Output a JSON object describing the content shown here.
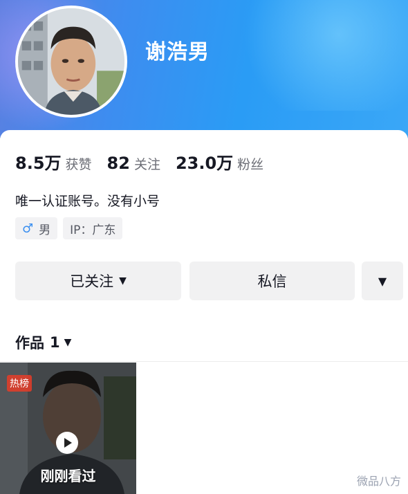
{
  "profile": {
    "nickname": "谢浩男",
    "bio": "唯一认证账号。没有小号"
  },
  "stats": [
    {
      "num": "8.5万",
      "label": "获赞"
    },
    {
      "num": "82",
      "label": "关注"
    },
    {
      "num": "23.0万",
      "label": "粉丝"
    }
  ],
  "tags": {
    "gender_icon": "♂",
    "gender": "男",
    "ip": "IP：广东"
  },
  "buttons": {
    "follow": "已关注",
    "follow_caret": "▼",
    "message": "私信",
    "more": "▼"
  },
  "works": {
    "label": "作品",
    "count": "1",
    "caret": "▼",
    "items": [
      {
        "badge": "热榜",
        "status": "刚刚看过",
        "icon": "play-icon"
      }
    ]
  },
  "watermark": "微品八方",
  "colors": {
    "header_gradient_start": "#5b7fe0",
    "header_gradient_end": "#3aa7f7",
    "gender_accent": "#3a8ff0",
    "hot_badge": "#e63c28"
  }
}
